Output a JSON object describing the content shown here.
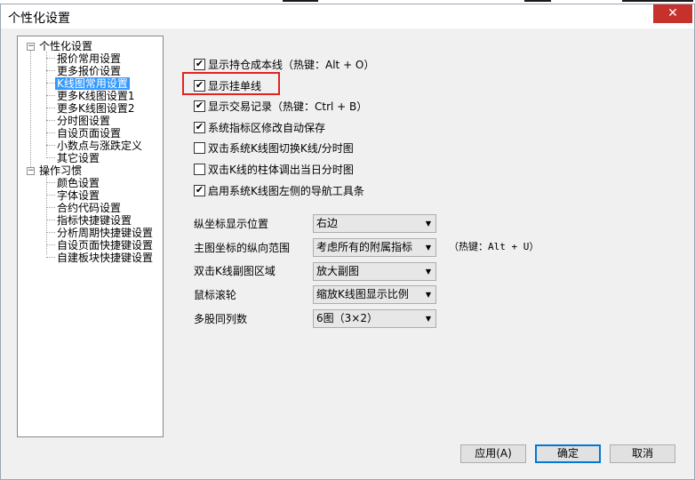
{
  "window": {
    "title": "个性化设置",
    "close_symbol": "✕"
  },
  "tree": {
    "groups": [
      {
        "label": "个性化设置",
        "expander": "−",
        "items": [
          "报价常用设置",
          "更多报价设置",
          "K线图常用设置",
          "更多K线图设置1",
          "更多K线图设置2",
          "分时图设置",
          "自设页面设置",
          "小数点与涨跌定义",
          "其它设置"
        ]
      },
      {
        "label": "操作习惯",
        "expander": "−",
        "items": [
          "颜色设置",
          "字体设置",
          "合约代码设置",
          "指标快捷键设置",
          "分析周期快捷键设置",
          "自设页面快捷键设置",
          "自建板块快捷键设置"
        ]
      }
    ],
    "selected": "K线图常用设置"
  },
  "options": [
    {
      "label": "显示持仓成本线（热键：Alt + O）",
      "checked": true
    },
    {
      "label": "显示挂单线",
      "checked": true
    },
    {
      "label": "显示交易记录（热键：Ctrl + B）",
      "checked": true
    },
    {
      "label": "系统指标区修改自动保存",
      "checked": true
    },
    {
      "label": "双击系统K线图切换K线/分时图",
      "checked": false
    },
    {
      "label": "双击K线的柱体调出当日分时图",
      "checked": false
    },
    {
      "label": "启用系统K线图左侧的导航工具条",
      "checked": true
    }
  ],
  "check_symbol": "✔",
  "fields": [
    {
      "label": "纵坐标显示位置",
      "value": "右边"
    },
    {
      "label": "主图坐标的纵向范围",
      "value": "考虑所有的附属指标"
    },
    {
      "label": "双击K线副图区域",
      "value": "放大副图"
    },
    {
      "label": "鼠标滚轮",
      "value": "缩放K线图显示比例"
    },
    {
      "label": "多股同列数",
      "value": "6图（3×2）"
    }
  ],
  "dropdown_arrow": "▼",
  "hotkey_note": "（热键：Alt + U）",
  "buttons": {
    "apply": "应用(A)",
    "ok": "确定",
    "cancel": "取消"
  },
  "colors": {
    "selection": "#3399ff",
    "close": "#c7312b",
    "highlight": "#e32222",
    "primary_border": "#0078d7"
  }
}
